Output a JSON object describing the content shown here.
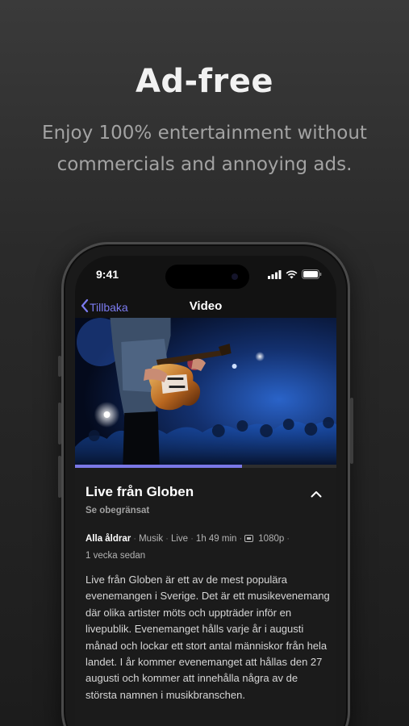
{
  "promo": {
    "title": "Ad-free",
    "subtitle": "Enjoy 100% entertainment without commercials and annoying ads."
  },
  "statusbar": {
    "time": "9:41",
    "icons": [
      "signal-icon",
      "wifi-icon",
      "battery-icon"
    ]
  },
  "navbar": {
    "back_label": "Tillbaka",
    "title": "Video"
  },
  "player": {
    "progress": 0.64,
    "accent": "#7a77e6"
  },
  "video_info": {
    "title": "Live från Globen",
    "availability": "Se obegränsat",
    "age_rating": "Alla åldrar",
    "genre": "Musik",
    "type": "Live",
    "duration": "1h 49 min",
    "quality": "1080p",
    "published": "1 vecka sedan",
    "description": "Live från Globen är ett av de mest populära evenemangen i Sverige. Det är ett musikevenemang där olika artister möts och uppträder inför en livepublik. Evenemanget hålls varje år i augusti månad och lockar ett stort antal människor från hela landet. I år kommer evenemanget att hållas den 27 augusti och kommer att innehålla några av de största namnen i musikbranschen."
  }
}
